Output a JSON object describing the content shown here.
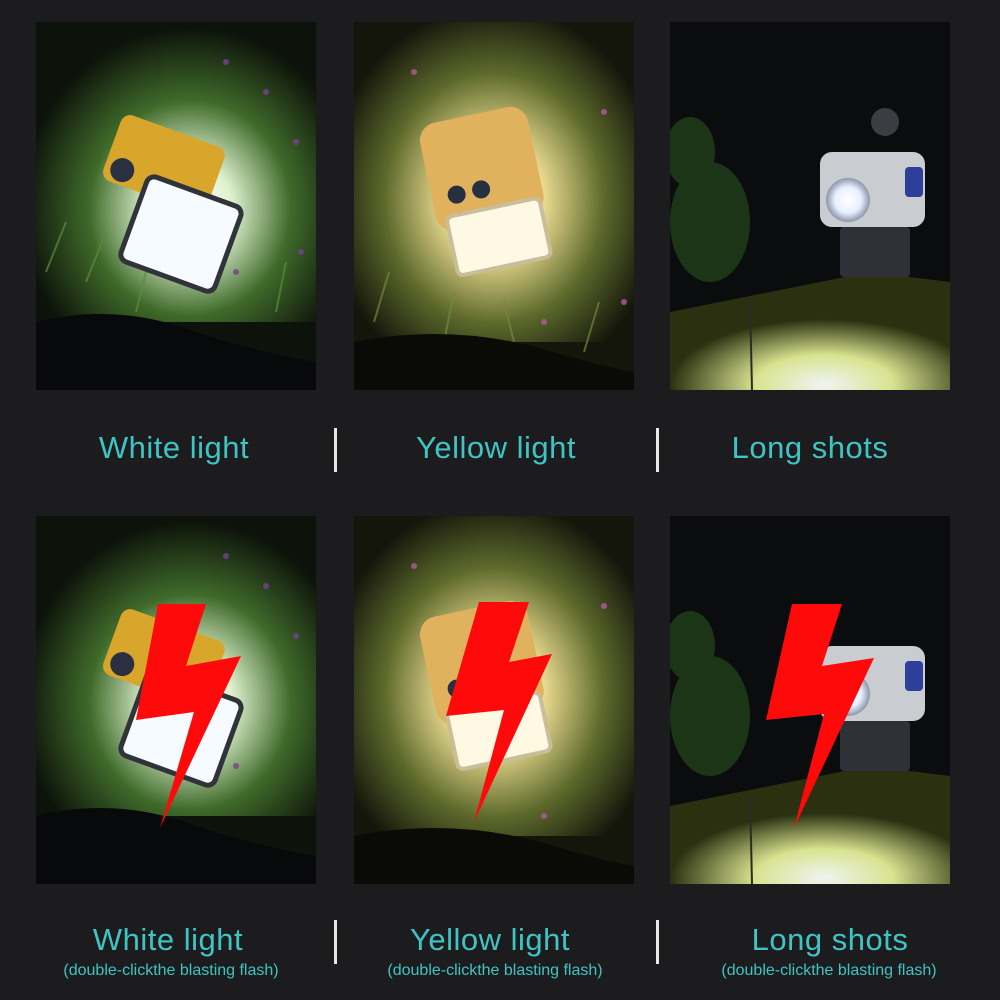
{
  "colors": {
    "background": "#1c1c1e",
    "caption": "#3fc4c4",
    "flash": "#ff0a0a",
    "white_light": "#f4f7ff",
    "yellow_light": "#fff2c4"
  },
  "rows": [
    {
      "panels": [
        {
          "caption": "White light",
          "mode": "white",
          "icon": "lantern-photo"
        },
        {
          "caption": "Yellow light",
          "mode": "yellow",
          "icon": "lantern-photo"
        },
        {
          "caption": "Long shots",
          "mode": "spot",
          "icon": "lantern-photo"
        }
      ]
    },
    {
      "panels": [
        {
          "caption": "White light",
          "note": "(double-clickthe blasting flash)",
          "mode": "white",
          "icon": "lightning-bolt-icon"
        },
        {
          "caption": "Yellow light",
          "note": "(double-clickthe blasting flash)",
          "mode": "yellow",
          "icon": "lightning-bolt-icon"
        },
        {
          "caption": "Long shots",
          "note": "(double-clickthe blasting flash)",
          "mode": "spot",
          "icon": "lightning-bolt-icon"
        }
      ]
    }
  ]
}
